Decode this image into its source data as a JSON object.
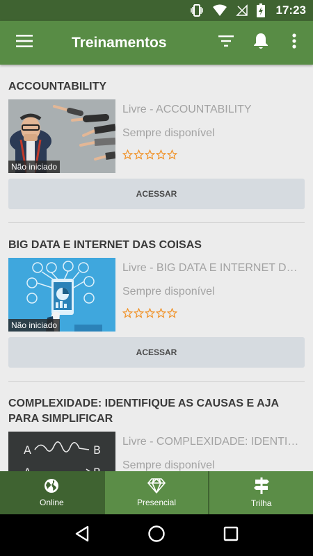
{
  "status_bar": {
    "time": "17:23"
  },
  "app_bar": {
    "title": "Treinamentos"
  },
  "colors": {
    "primary": "#588c45",
    "primary_dark": "#3f6331",
    "star": "#f0932a",
    "button": "#d6dbe0"
  },
  "cards": [
    {
      "title": "ACCOUNTABILITY",
      "line1": "Livre - ACCOUNTABILITY",
      "line2": "Sempre disponível",
      "badge": "Não iniciado",
      "rating": 0,
      "button": "ACESSAR"
    },
    {
      "title": "BIG DATA E INTERNET DAS COISAS",
      "line1": "Livre - BIG DATA E INTERNET DAS COISAS",
      "line2": "Sempre disponível",
      "badge": "Não iniciado",
      "rating": 0,
      "button": "ACESSAR"
    },
    {
      "title": "COMPLEXIDADE: IDENTIFIQUE AS CAUSAS E AJA PARA SIMPLIFICAR",
      "line1": "Livre - COMPLEXIDADE: IDENTIFIQUE AS CAUSAS E AJA PARA SIMPLIFICAR",
      "line2": "Sempre disponível"
    }
  ],
  "bottom_nav": [
    {
      "label": "Online",
      "icon": "globe-icon",
      "active": true
    },
    {
      "label": "Presencial",
      "icon": "diamond-icon",
      "active": false
    },
    {
      "label": "Trilha",
      "icon": "signpost-icon",
      "active": false
    }
  ]
}
